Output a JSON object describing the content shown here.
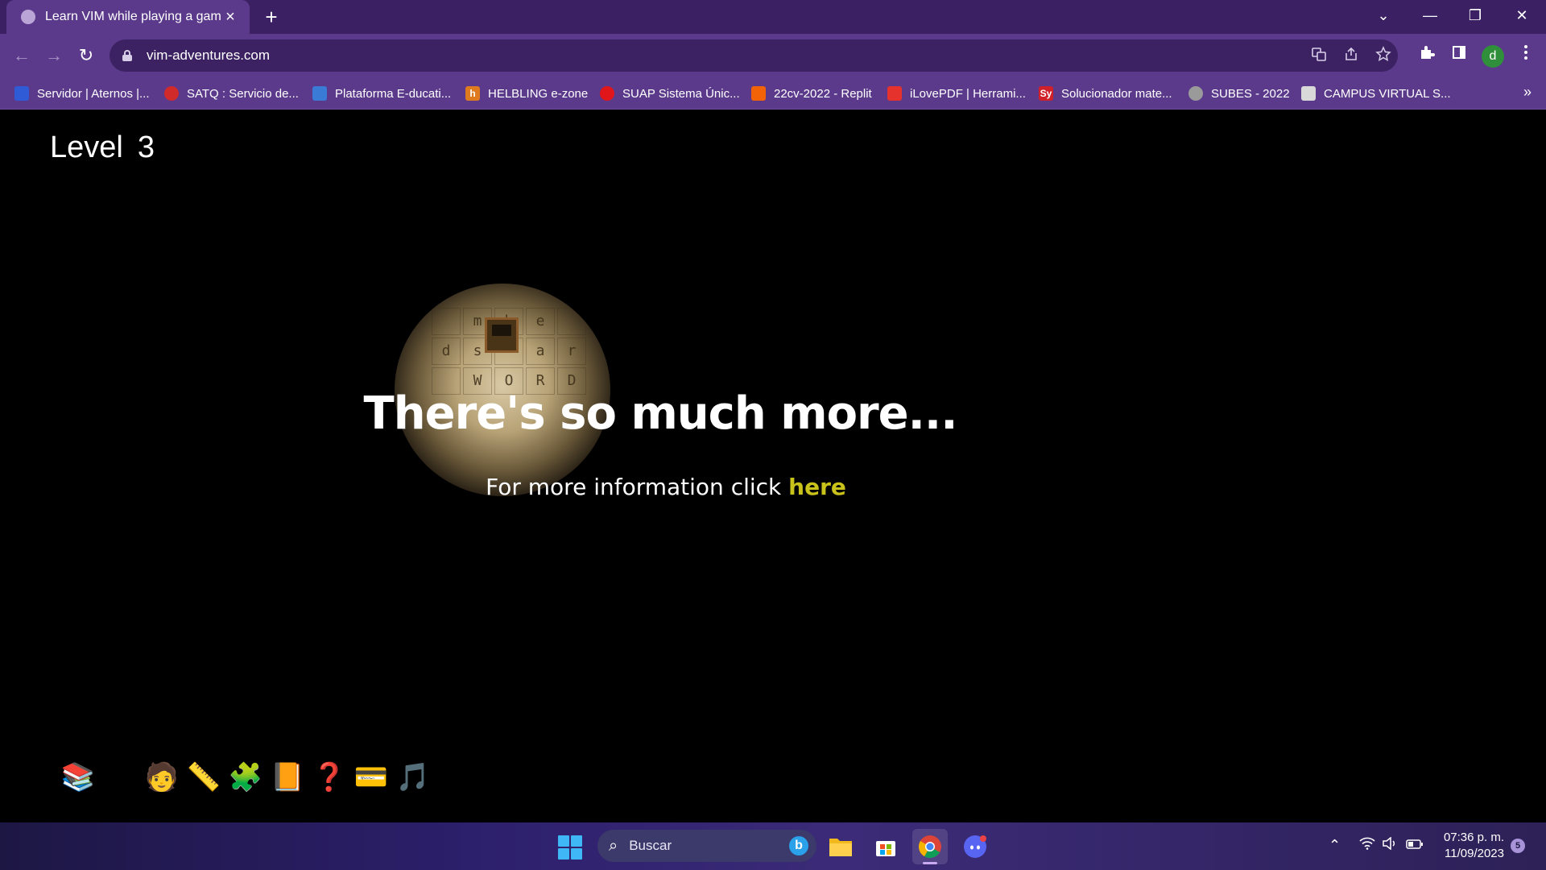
{
  "browser": {
    "tab_title": "Learn VIM while playing a game",
    "tab_close": "×",
    "new_tab": "+",
    "url": "vim-adventures.com",
    "avatar_letter": "d",
    "window_controls": {
      "minimize": "—",
      "restore": "❐",
      "close": "✕",
      "tab_search": "⌄"
    },
    "nav": {
      "back": "←",
      "forward": "→",
      "reload": "↻"
    },
    "bookmarks": [
      {
        "label": "Servidor | Aternos |...",
        "icon_color": "#2f5bd6"
      },
      {
        "label": "SATQ : Servicio de...",
        "icon_color": "#d12a2a"
      },
      {
        "label": "Plataforma E-ducati...",
        "icon_color": "#3a7bd5"
      },
      {
        "label": "HELBLING e-zone",
        "icon_color": "#e07a1f",
        "icon_text": "h"
      },
      {
        "label": "SUAP Sistema Únic...",
        "icon_color": "#e0161b"
      },
      {
        "label": "22cv-2022 - Replit",
        "icon_color": "#f26207"
      },
      {
        "label": "iLovePDF | Herrami...",
        "icon_color": "#e5322d"
      },
      {
        "label": "Solucionador mate...",
        "icon_color": "#d0202a",
        "icon_text": "Sy"
      },
      {
        "label": "SUBES - 2022",
        "icon_color": "#9a9a9a"
      },
      {
        "label": "CAMPUS VIRTUAL S...",
        "icon_color": "#d9d9d9"
      }
    ],
    "bookmarks_more": "»"
  },
  "game": {
    "level_label": "Level",
    "level_number": "3",
    "grid_letters": [
      "",
      "m",
      "h",
      "e",
      "",
      "d",
      "s",
      "",
      "a",
      "r",
      "",
      "W",
      "O",
      "R",
      "D"
    ],
    "headline": "There's so much more...",
    "info_text": "For more information click ",
    "info_link": "here",
    "toolbox": [
      {
        "name": "books-icon",
        "glyph": "📚"
      },
      {
        "name": "keyboard-icon",
        "glyph": "⌨"
      },
      {
        "name": "person-icon",
        "glyph": "🧑"
      },
      {
        "name": "ruler-icon",
        "glyph": "📏"
      },
      {
        "name": "puzzle-icon",
        "glyph": "🧩"
      },
      {
        "name": "book-icon",
        "glyph": "📙"
      },
      {
        "name": "help-icon",
        "glyph": "❓"
      },
      {
        "name": "card-icon",
        "glyph": "💳"
      },
      {
        "name": "music-icon",
        "glyph": "🎵"
      }
    ]
  },
  "taskbar": {
    "search_placeholder": "Buscar",
    "time": "07:36 p. m.",
    "date": "11/09/2023",
    "notification_count": "5"
  }
}
